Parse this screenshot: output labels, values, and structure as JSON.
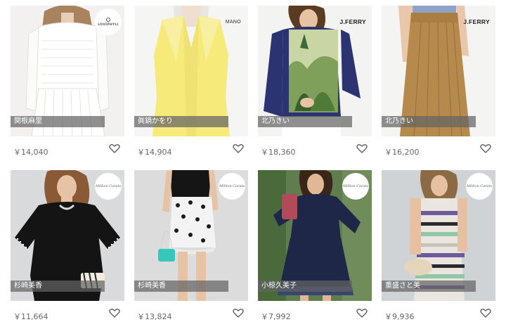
{
  "products": [
    {
      "name": "関根麻里",
      "price": "￥14,040",
      "logo": "LOUIPHYLI",
      "logo_style": "circle-lou",
      "bg": "#f2f1ef",
      "accent": "#ffffff",
      "skin": "#e8cdb7",
      "hair": "#a9835d",
      "skirt": "#ffffff"
    },
    {
      "name": "眞鍋かをり",
      "price": "￥14,904",
      "logo": "MANO",
      "logo_style": "text-mano",
      "bg": "#f5f5f3",
      "accent": "#f5ea7a",
      "skin": "#f0dfd0",
      "hair": "#e6e6e2",
      "skirt": "#f5ea7a"
    },
    {
      "name": "北乃きい",
      "price": "￥18,360",
      "logo": "J.FERRY",
      "logo_style": "text",
      "bg": "#f3f3f1",
      "accent": "#2b3370",
      "skin": "#e7c2a3",
      "hair": "#5b3b22",
      "skirt": "#ffffff"
    },
    {
      "name": "北乃きい",
      "price": "￥16,200",
      "logo": "J.FERRY",
      "logo_style": "text",
      "bg": "#f4f4f2",
      "accent": "#b58a4c",
      "skin": "#e8c7aa",
      "hair": "#6b4a2e",
      "skirt": "#b58a4c"
    },
    {
      "name": "杉崎美香",
      "price": "￥11,664",
      "logo": "Million Carats",
      "logo_style": "circle",
      "bg": "#d9dadc",
      "accent": "#141414",
      "skin": "#e6c3a5",
      "hair": "#8a5a36",
      "skirt": "#1a1a1a"
    },
    {
      "name": "杉崎美香",
      "price": "￥13,824",
      "logo": "Million Carats",
      "logo_style": "circle",
      "bg": "#dcdcdc",
      "accent": "#151515",
      "skin": "#e6c3a5",
      "hair": "#2a1d16",
      "skirt": "#f3f3f3"
    },
    {
      "name": "小椋久美子",
      "price": "￥7,992",
      "logo": "Million Carats",
      "logo_style": "circle",
      "bg": "#5f7d4e",
      "accent": "#1e2748",
      "skin": "#e0b896",
      "hair": "#3a2619",
      "skirt": "#1e2748"
    },
    {
      "name": "重盛さと美",
      "price": "￥9,936",
      "logo": "Million Carats",
      "logo_style": "circle",
      "bg": "#cfd3d6",
      "accent": "#eae6df",
      "skin": "#e6c0a0",
      "hair": "#8c6a43",
      "skirt": "#eae6df"
    }
  ]
}
